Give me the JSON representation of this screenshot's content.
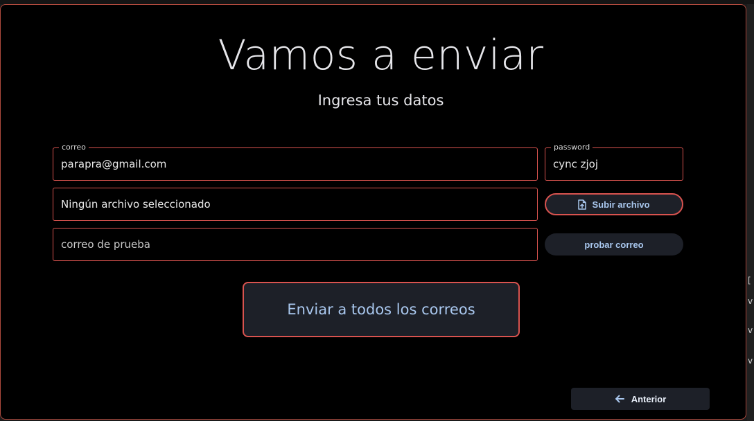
{
  "header": {
    "title": "Vamos a enviar",
    "subtitle": "Ingresa tus datos"
  },
  "form": {
    "email": {
      "legend": "correo",
      "value": "parapra@gmail.com"
    },
    "password": {
      "legend": "password",
      "value": "cync zjoj"
    },
    "file": {
      "value": "Ningún archivo seleccionado"
    },
    "test_email": {
      "placeholder": "correo de prueba"
    }
  },
  "buttons": {
    "upload_label": "Subir archivo",
    "test_label": "probar correo",
    "send_label": "Enviar a todos los correos",
    "prev_label": "Anterior"
  },
  "icons": {
    "upload": "file-upload-icon",
    "prev": "arrow-left-icon"
  },
  "colors": {
    "border_accent": "#d9534f",
    "button_bg": "#1d2028",
    "button_text": "#a9c7ee",
    "background": "#000000"
  }
}
